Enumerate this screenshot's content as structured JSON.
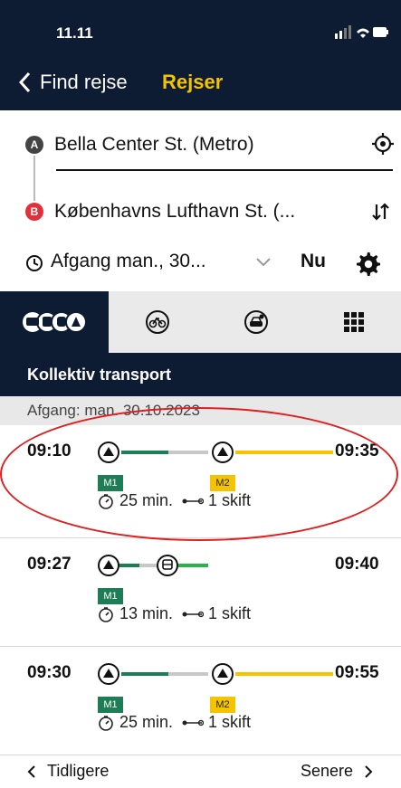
{
  "status_bar": {
    "time": "11.11"
  },
  "header": {
    "back_label": "Find rejse",
    "title": "Rejser"
  },
  "stops": {
    "from_badge": "A",
    "from": "Bella Center St. (Metro)",
    "to_badge": "B",
    "to": "Københavns Lufthavn St. (..."
  },
  "time_select": {
    "value": "Afgang man., 30...",
    "now_label": "Nu"
  },
  "tabs": [
    {
      "icon": "public-transport-icon",
      "active": true
    },
    {
      "icon": "bike-icon",
      "active": false
    },
    {
      "icon": "car-icon",
      "active": false
    },
    {
      "icon": "grid-icon",
      "active": false
    }
  ],
  "section_title": "Kollektiv transport",
  "date_label": "Afgang: man. 30.10.2023",
  "trips": [
    {
      "dep": "09:10",
      "arr": "09:35",
      "lines": [
        "M1",
        "M2"
      ],
      "duration": "25 min.",
      "transfers": "1 skift"
    },
    {
      "dep": "09:27",
      "arr": "09:40",
      "lines": [
        "M1"
      ],
      "duration": "13 min.",
      "transfers": "1 skift"
    },
    {
      "dep": "09:30",
      "arr": "09:55",
      "lines": [
        "M1",
        "M2"
      ],
      "duration": "25 min.",
      "transfers": "1 skift"
    }
  ],
  "footer": {
    "earlier": "Tidligere",
    "later": "Senere"
  },
  "colors": {
    "navy": "#0d1b33",
    "accent_yellow": "#f5c400",
    "metro_green": "#1e7d54",
    "highlight_red": "#e02020"
  }
}
